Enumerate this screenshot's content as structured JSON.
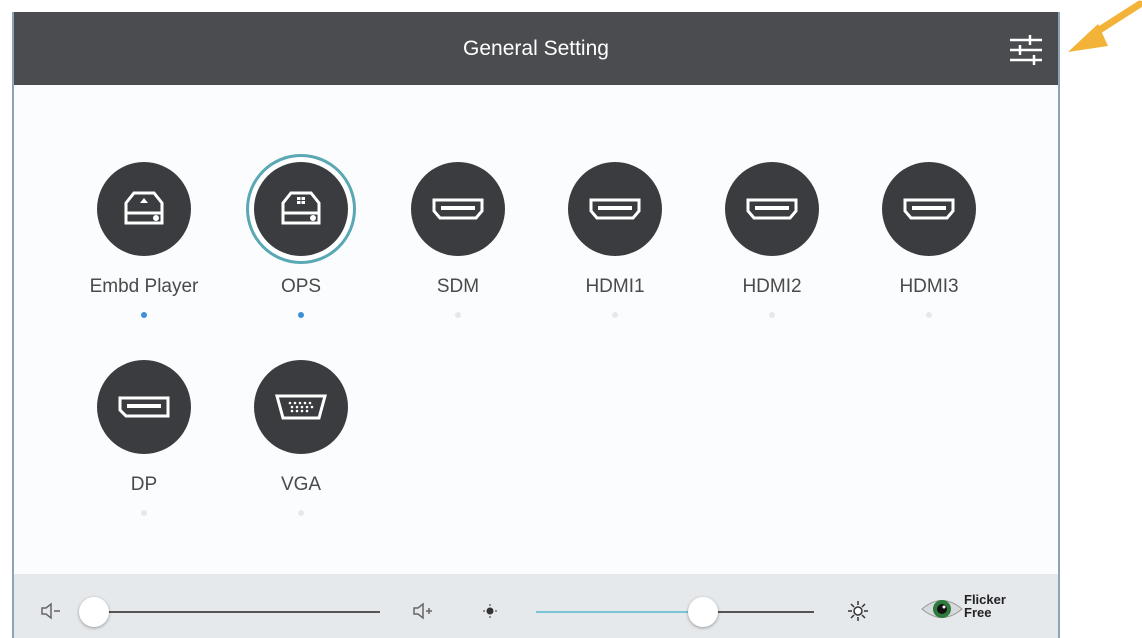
{
  "header": {
    "title": "General Setting",
    "settings_icon": "sliders-icon"
  },
  "sources": [
    {
      "label": "Embd Player",
      "icon": "media-player-icon",
      "active": true,
      "selected": false
    },
    {
      "label": "OPS",
      "icon": "ops-icon",
      "active": true,
      "selected": true
    },
    {
      "label": "SDM",
      "icon": "hdmi-port-icon",
      "active": false,
      "selected": false
    },
    {
      "label": "HDMI1",
      "icon": "hdmi-port-icon",
      "active": false,
      "selected": false
    },
    {
      "label": "HDMI2",
      "icon": "hdmi-port-icon",
      "active": false,
      "selected": false
    },
    {
      "label": "HDMI3",
      "icon": "hdmi-port-icon",
      "active": false,
      "selected": false
    },
    {
      "label": "DP",
      "icon": "displayport-icon",
      "active": false,
      "selected": false
    },
    {
      "label": "VGA",
      "icon": "vga-port-icon",
      "active": false,
      "selected": false
    }
  ],
  "footer": {
    "volume_level": 0,
    "brightness_level": 0.6,
    "flicker_free_line1": "Flicker",
    "flicker_free_line2": "Free"
  },
  "colors": {
    "header_bg": "#4b4c50",
    "accent": "#5aa8b4",
    "active_dot": "#3d8fd8",
    "arrow": "#f3b338"
  }
}
